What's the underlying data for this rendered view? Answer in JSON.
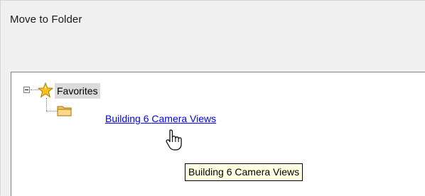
{
  "dialog": {
    "title": "Move to Folder"
  },
  "tree": {
    "root": {
      "label": "Favorites",
      "icon": "star-icon",
      "expanded": true,
      "children": [
        {
          "label": "Building 6 Camera Views",
          "icon": "folder-icon"
        }
      ]
    }
  },
  "tooltip": {
    "text": "Building 6 Camera Views"
  },
  "colors": {
    "link": "#0000ee",
    "tooltip_bg": "#ffffe1",
    "selection_bg": "#dcdcdc"
  }
}
